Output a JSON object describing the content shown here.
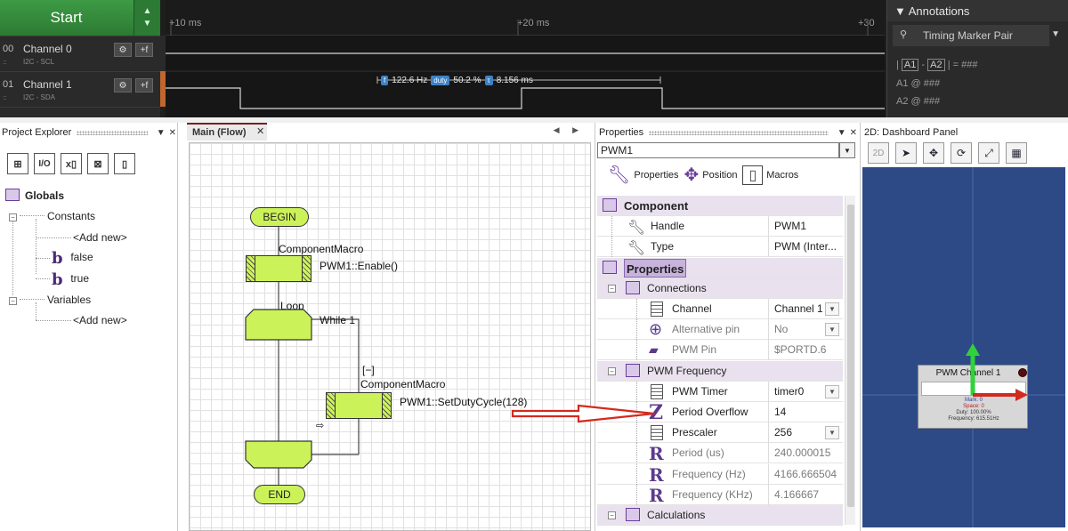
{
  "analyzer": {
    "start_label": "Start",
    "spin_up": "▲",
    "spin_down": "▼",
    "channels": [
      {
        "num": "00",
        "name": "Channel 0",
        "sub": "I2C - SCL",
        "dots": "::::"
      },
      {
        "num": "01",
        "name": "Channel 1",
        "sub": "I2C - SDA",
        "dots": "::::"
      }
    ],
    "gear_glyph": "⚙",
    "trigger_glyph": "+f",
    "ticks": [
      "+10 ms",
      "+20 ms",
      "+30"
    ],
    "measure": {
      "freq_badge": "f",
      "freq": "122.6 Hz",
      "duty_badge": "duty",
      "duty": "50.2 %",
      "period_badge": "τ",
      "period": "8.156 ms"
    },
    "annotations": {
      "title": "Annotations",
      "selector": "Timing Marker Pair",
      "pair_a1": "A1",
      "pair_a2": "A2",
      "pair_value": "| = ###",
      "a1_label": "A1  @  ###",
      "a2_label": "A2  @  ###"
    }
  },
  "project_explorer": {
    "title": "Project Explorer",
    "tools": [
      "⊞",
      "I/O",
      "x▯",
      "⊠",
      "▯"
    ],
    "globals": "Globals",
    "constants": "Constants",
    "add_new_1": "<Add new>",
    "false_label": "false",
    "true_label": "true",
    "variables": "Variables",
    "add_new_2": "<Add new>",
    "bool_glyph": "b"
  },
  "flow": {
    "tab_label": "Main (Flow)",
    "close": "✕",
    "nav": "◀ ▶",
    "begin": "BEGIN",
    "macro1_title": "ComponentMacro",
    "macro1_call": "PWM1::Enable()",
    "loop_label": "Loop",
    "loop_cond": "While 1",
    "collapse": "[−]",
    "macro2_title": "ComponentMacro",
    "macro2_call": "PWM1::SetDutyCycle(128)",
    "end": "END"
  },
  "properties": {
    "title": "Properties",
    "selected": "PWM1",
    "tabs": {
      "properties": "Properties",
      "position": "Position",
      "macros": "Macros"
    },
    "rows": [
      {
        "name": "Component",
        "value": "",
        "kind": "cat"
      },
      {
        "name": "Handle",
        "value": "PWM1",
        "kind": "item"
      },
      {
        "name": "Type",
        "value": "PWM (Inter...",
        "kind": "item"
      },
      {
        "name": "Properties",
        "value": "",
        "kind": "cat"
      },
      {
        "name": "Connections",
        "value": "",
        "kind": "sub"
      },
      {
        "name": "Channel",
        "value": "Channel 1",
        "kind": "item",
        "dd": true
      },
      {
        "name": "Alternative pin",
        "value": "No",
        "kind": "dim",
        "dd": true
      },
      {
        "name": "PWM Pin",
        "value": "$PORTD.6",
        "kind": "dim"
      },
      {
        "name": "PWM Frequency",
        "value": "",
        "kind": "sub"
      },
      {
        "name": "PWM Timer",
        "value": "timer0",
        "kind": "item",
        "dd": true
      },
      {
        "name": "Period Overflow",
        "value": "14",
        "kind": "item"
      },
      {
        "name": "Prescaler",
        "value": "256",
        "kind": "item",
        "dd": true
      },
      {
        "name": "Period (us)",
        "value": "240.000015",
        "kind": "dim"
      },
      {
        "name": "Frequency (Hz)",
        "value": "4166.666504",
        "kind": "dim"
      },
      {
        "name": "Frequency (KHz)",
        "value": "4.166667",
        "kind": "dim"
      },
      {
        "name": "Calculations",
        "value": "",
        "kind": "sub"
      }
    ]
  },
  "dashboard": {
    "title": "2D: Dashboard Panel",
    "tools": [
      "2D",
      "➤",
      "✥",
      "⟳",
      "⤢",
      "▦"
    ],
    "widget_title": "PWM Channel 1",
    "widget_mark": "Mark: 0",
    "widget_space": "Space: 0",
    "widget_duty": "Duty: 100.00%",
    "widget_freq": "Frequency: 615.51Hz"
  },
  "colors": {
    "accent_purple": "#6a3d9a",
    "flow_green": "#ccf25a",
    "arrow_red": "#d42a1f",
    "dash_blue": "#2d4a87"
  }
}
